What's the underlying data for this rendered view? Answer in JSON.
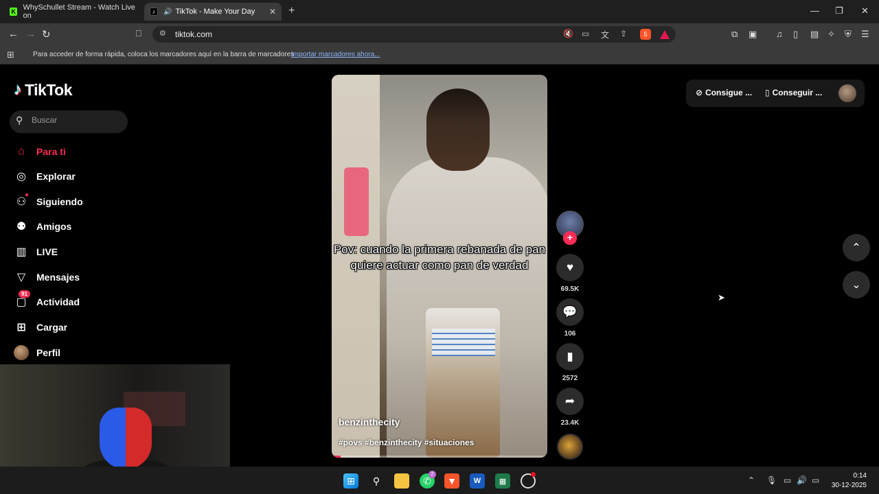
{
  "browser": {
    "tabs": [
      {
        "title": "WhySchullet Stream - Watch Live on",
        "favicon": "kick-icon"
      },
      {
        "title": "TikTok - Make Your Day",
        "favicon": "tiktok-icon",
        "active": true
      }
    ],
    "url": "tiktok.com",
    "bookmarks_hint": "Para acceder de forma rápida, coloca los marcadores aquí en la barra de marcadores",
    "bookmarks_link": "Importar marcadores ahora...",
    "brave_shield_count": "5"
  },
  "tiktok": {
    "logo": "TikTok",
    "search_placeholder": "Buscar",
    "nav": [
      {
        "label": "Para ti",
        "icon": "home-icon",
        "active": true
      },
      {
        "label": "Explorar",
        "icon": "compass-icon"
      },
      {
        "label": "Siguiendo",
        "icon": "following-icon"
      },
      {
        "label": "Amigos",
        "icon": "friends-icon"
      },
      {
        "label": "LIVE",
        "icon": "live-icon"
      },
      {
        "label": "Mensajes",
        "icon": "send-icon"
      },
      {
        "label": "Actividad",
        "icon": "inbox-icon",
        "badge": "91"
      },
      {
        "label": "Cargar",
        "icon": "upload-icon"
      },
      {
        "label": "Perfil",
        "icon": "avatar"
      }
    ],
    "top_actions": {
      "coins": "Consigue ...",
      "app": "Conseguir ..."
    },
    "video": {
      "caption": "Pov: cuando la primera rebanada de pan quiere actuar como pan de verdad",
      "author": "benzinthecity",
      "hashtags": "#povs #benzinthecity #situaciones",
      "progress": 0.04
    },
    "actions": {
      "likes": "69.5K",
      "comments": "106",
      "saves": "2572",
      "shares": "23.4K"
    }
  },
  "taskbar": {
    "whatsapp_badge": "2",
    "time": "0:14",
    "date": "30-12-2025"
  },
  "colors": {
    "accent": "#fe2c55",
    "browser_bg": "#3a3a3a",
    "tab_bg": "#1f1f1f"
  }
}
